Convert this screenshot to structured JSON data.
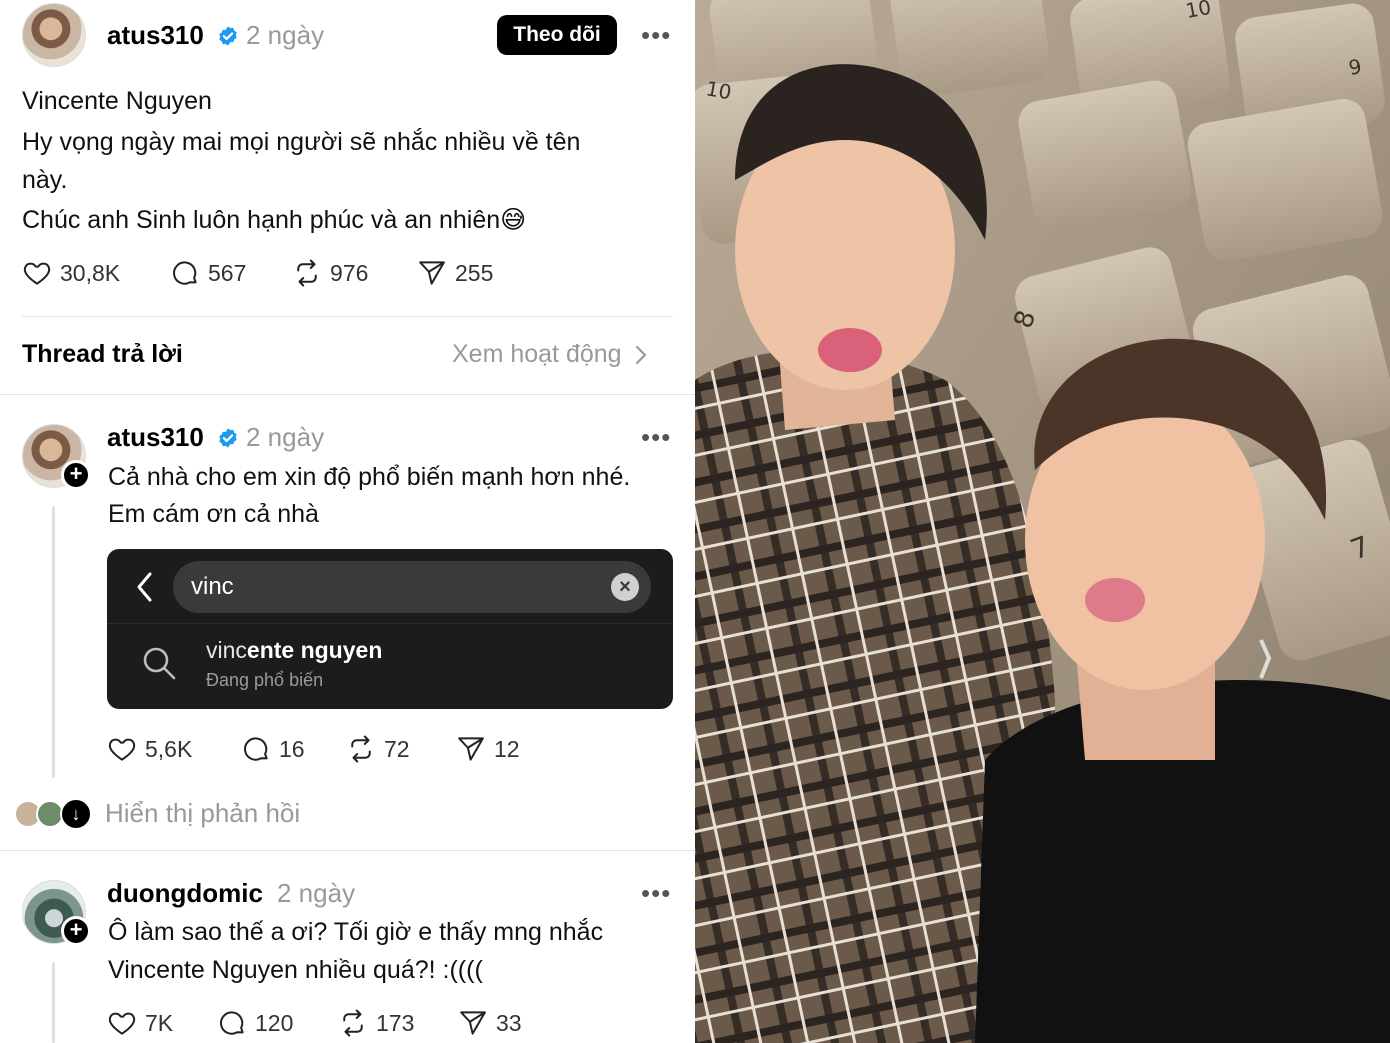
{
  "post": {
    "username": "atus310",
    "time": "2 ngày",
    "follow_label": "Theo dõi",
    "lines": [
      "Vincente Nguyen",
      "Hy vọng ngày mai mọi người sẽ nhắc nhiều về tên",
      "này.",
      "Chúc anh Sinh luôn hạnh phúc và an nhiên😅"
    ],
    "likes": "30,8K",
    "comments": "567",
    "reposts": "976",
    "shares": "255"
  },
  "section": {
    "title": "Thread trả lời",
    "link": "Xem hoạt động"
  },
  "reply1": {
    "username": "atus310",
    "time": "2 ngày",
    "lines": [
      "Cả nhà cho em xin độ phổ biến mạnh hơn nhé.",
      "Em cám ơn cả nhà"
    ],
    "search": {
      "query": "vinc",
      "suggestion_typed": "vinc",
      "suggestion_rest": "ente nguyen",
      "suggestion_sub": "Đang phổ biến"
    },
    "likes": "5,6K",
    "comments": "16",
    "reposts": "72",
    "shares": "12",
    "show_replies": "Hiển thị phản hồi"
  },
  "reply2": {
    "username": "duongdomic",
    "time": "2 ngày",
    "lines": [
      "Ô làm sao thế a ơi? Tối giờ e thấy mng nhắc",
      "Vincente Nguyen nhiều quá?! :(((("
    ],
    "likes": "7K",
    "comments": "120",
    "reposts": "173",
    "shares": "33"
  },
  "photo": {
    "seat_numbers": [
      "10",
      "10",
      "9",
      "8",
      "7"
    ]
  },
  "colors": {
    "verified": "#1d9bf0",
    "muted": "#999999",
    "search_bg": "#1c1c1e"
  }
}
